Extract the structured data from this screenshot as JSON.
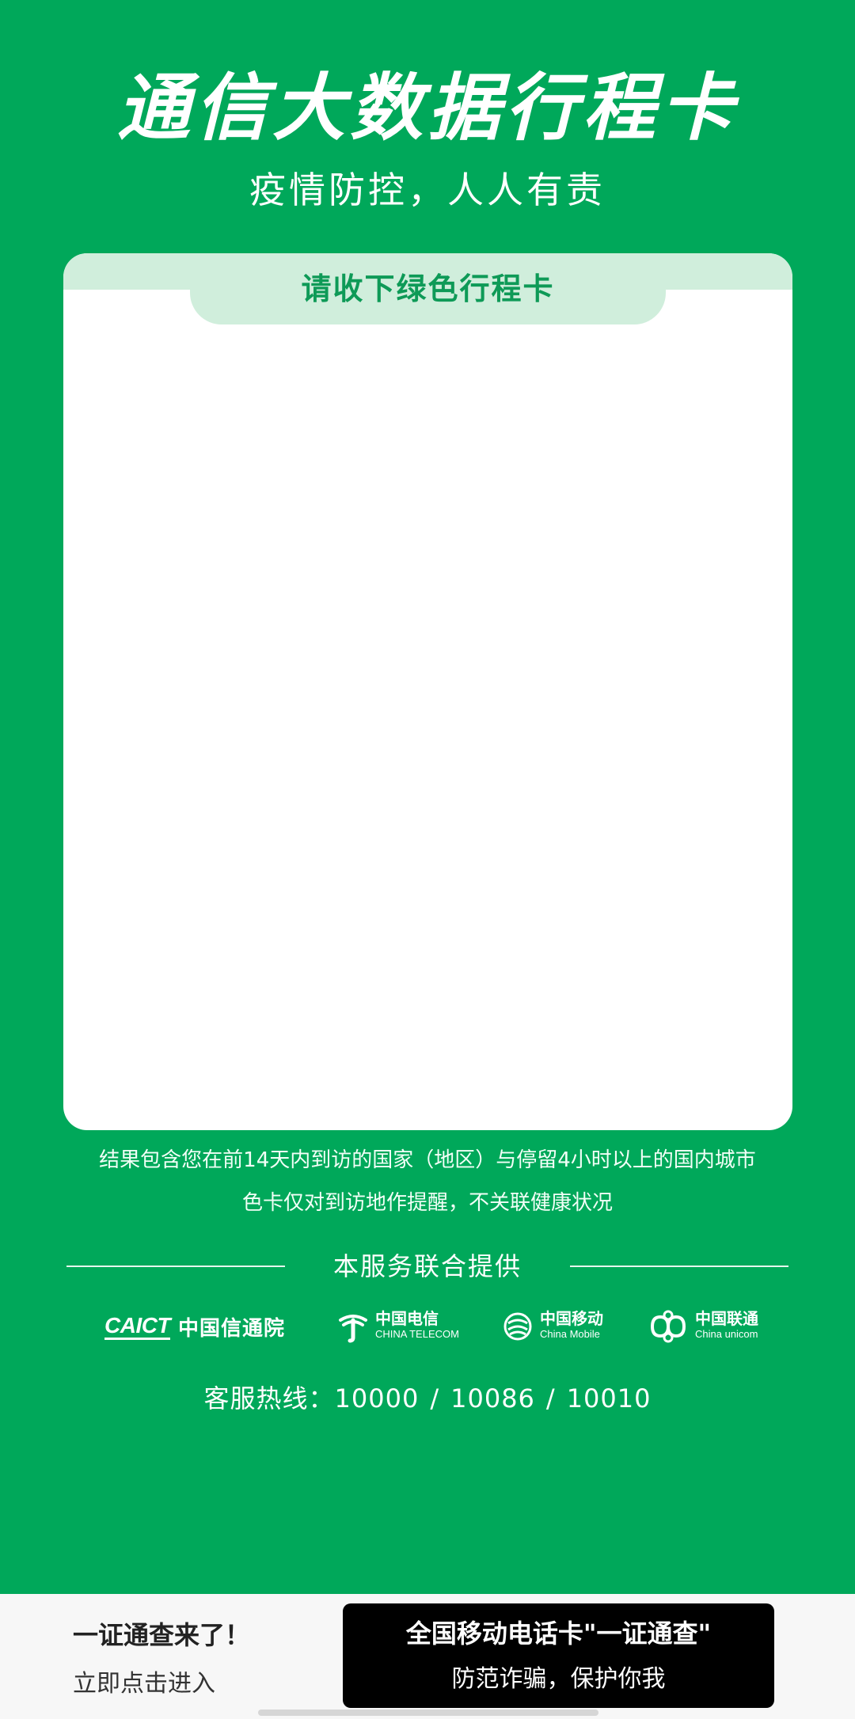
{
  "header": {
    "title": "通信大数据行程卡",
    "subtitle": "疫情防控，人人有责"
  },
  "card": {
    "tab_label": "请收下绿色行程卡"
  },
  "notes": {
    "line1": "结果包含您在前14天内到访的国家（地区）与停留4小时以上的国内城市",
    "line2": "色卡仅对到访地作提醒，不关联健康状况"
  },
  "providers": {
    "label": "本服务联合提供",
    "logos": [
      {
        "mark": "CAICT",
        "name": "中国信通院"
      },
      {
        "name": "中国电信",
        "en": "CHINA TELECOM"
      },
      {
        "name": "中国移动",
        "en": "China Mobile"
      },
      {
        "name": "中国联通",
        "en": "China unicom"
      }
    ]
  },
  "hotline": {
    "label": "客服热线：",
    "numbers": [
      "10000",
      "10086",
      "10010"
    ],
    "separator": "/"
  },
  "promo": {
    "left_title": "一证通查来了！",
    "left_subtitle": "立即点击进入",
    "button_title": "全国移动电话卡\"一证通查\"",
    "button_subtitle": "防范诈骗，保护你我"
  },
  "colors": {
    "brand_green": "#00A85A",
    "tab_green": "#D0EEDC",
    "tab_text": "#0E9A57"
  }
}
